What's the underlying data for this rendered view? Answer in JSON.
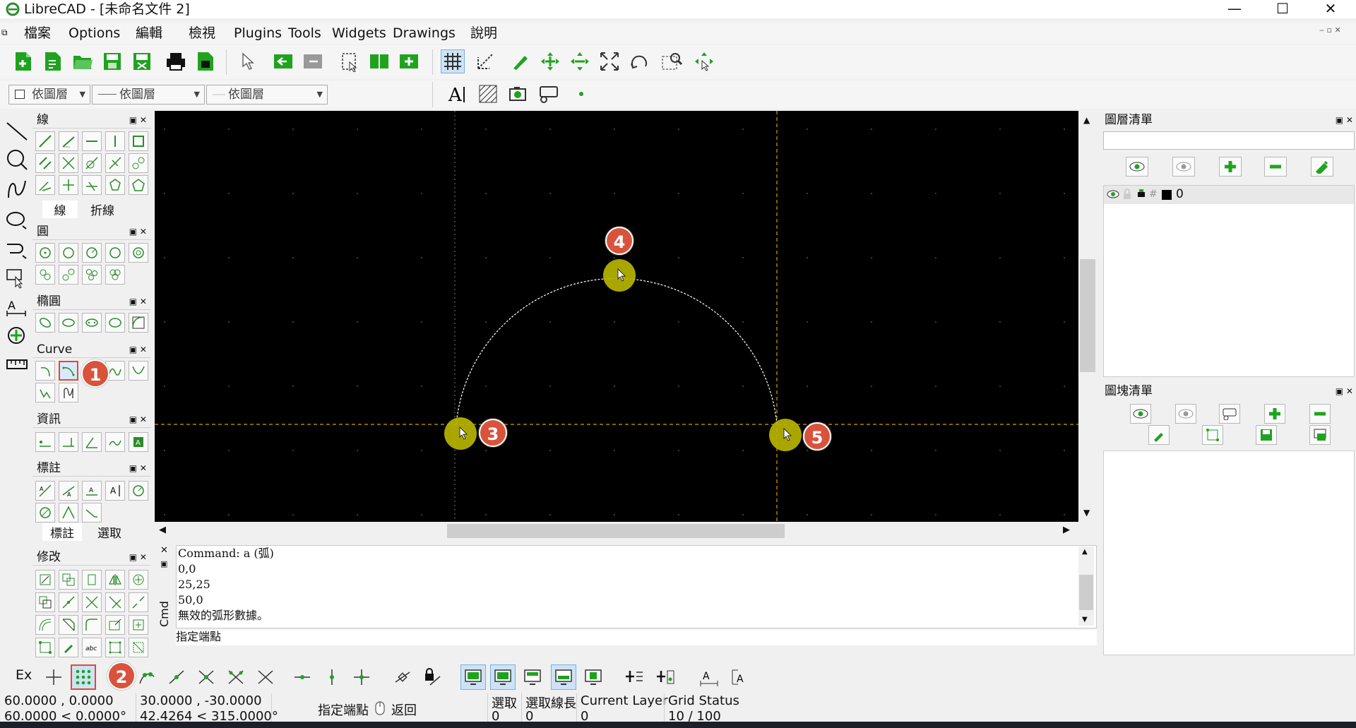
{
  "window": {
    "title": "LibreCAD - [未命名文件 2]",
    "minimize": "—",
    "maximize": "☐",
    "close": "✕"
  },
  "menu": [
    "檔案",
    "Options",
    "編輯",
    "檢視",
    "Plugins",
    "Tools",
    "Widgets",
    "Drawings",
    "說明"
  ],
  "pen": {
    "color": "依圖層",
    "linetype": "依圖層",
    "width": "依圖層"
  },
  "docks": {
    "line": {
      "title": "線",
      "tabs": [
        "線",
        "折線"
      ]
    },
    "circle": {
      "title": "圓"
    },
    "ellipse": {
      "title": "橢圓"
    },
    "curve": {
      "title": "Curve"
    },
    "info": {
      "title": "資訊"
    },
    "dim": {
      "title": "標註",
      "tabs": [
        "標註",
        "選取"
      ]
    },
    "modify": {
      "title": "修改"
    }
  },
  "layers": {
    "title": "圖層清單",
    "items": [
      {
        "name": "0"
      }
    ]
  },
  "blocks": {
    "title": "圖塊清單"
  },
  "command": {
    "label": "Cmd",
    "lines": [
      "Command: a (弧)",
      "0,0",
      "25,25",
      "50,0",
      "無效的弧形數據。"
    ],
    "prompt": "指定端點"
  },
  "snap": {
    "ex": "Ex"
  },
  "status": {
    "abs": "60.0000 , 0.0000",
    "abs_polar": "60.0000 < 0.0000°",
    "rel": "30.0000 , -30.0000",
    "rel_polar": "42.4264 < 315.0000°",
    "mouse_left": "指定端點",
    "mouse_right": "返回",
    "selected_label": "選取",
    "selected_value": "0",
    "sel_len_label": "選取線長",
    "sel_len_value": "0",
    "layer_label": "Current Layer",
    "layer_value": "0",
    "grid_label": "Grid Status",
    "grid_value": "10 / 100"
  },
  "callouts": [
    "1",
    "2",
    "3",
    "4",
    "5"
  ],
  "colors": {
    "canvas": "#000000",
    "guide": "#d4a000",
    "arc": "#ffffff",
    "callout": "#d9533c",
    "highlight": "#b9b400"
  }
}
